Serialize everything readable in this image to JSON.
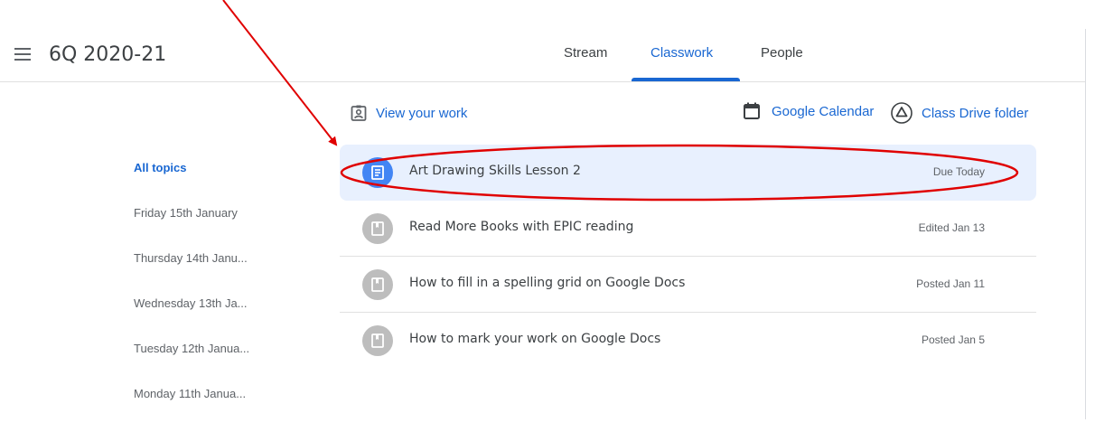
{
  "header": {
    "class_name": "6Q 2020-21",
    "tabs": [
      {
        "label": "Stream"
      },
      {
        "label": "Classwork"
      },
      {
        "label": "People"
      }
    ]
  },
  "toolbar": {
    "view_your_work": "View your work",
    "google_calendar": "Google Calendar",
    "class_drive_folder": "Class Drive folder"
  },
  "topics": [
    {
      "label": "All topics"
    },
    {
      "label": "Friday 15th January"
    },
    {
      "label": "Thursday 14th Janu..."
    },
    {
      "label": "Wednesday 13th Ja..."
    },
    {
      "label": "Tuesday 12th Janua..."
    },
    {
      "label": "Monday 11th Janua..."
    }
  ],
  "classwork": [
    {
      "title": "Art Drawing Skills Lesson 2",
      "status": "Due Today",
      "icon": "assignment-icon"
    },
    {
      "title": "Read More Books with EPIC reading",
      "status": "Edited Jan 13",
      "icon": "material-icon"
    },
    {
      "title": "How to fill in a spelling grid on Google Docs",
      "status": "Posted Jan 11",
      "icon": "material-icon"
    },
    {
      "title": "How to mark your work on Google Docs",
      "status": "Posted Jan 5",
      "icon": "material-icon"
    }
  ],
  "colors": {
    "accent": "#1967d2",
    "highlight_bg": "#e8f0fe",
    "annotation": "#e00000"
  }
}
